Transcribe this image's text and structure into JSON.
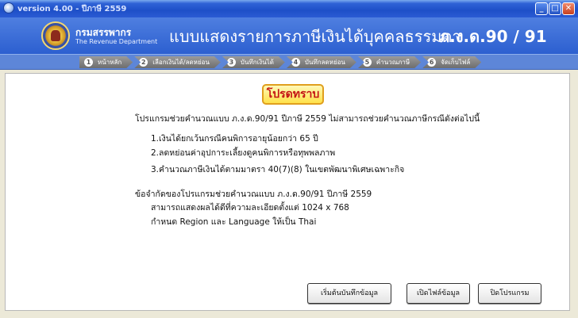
{
  "window": {
    "title": "version 4.00 - ปีภาษี 2559"
  },
  "header": {
    "dept_th": "กรมสรรพากร",
    "dept_en": "The Revenue Department",
    "form_title": "แบบแสดงรายการภาษีเงินได้บุคคลธรรมดา",
    "form_code": "ภ.ง.ด.90 / 91"
  },
  "steps": [
    {
      "num": "1",
      "label": "หน้าหลัก"
    },
    {
      "num": "2",
      "label": "เลือกเงินได้/ลดหย่อน"
    },
    {
      "num": "3",
      "label": "บันทึกเงินได้"
    },
    {
      "num": "4",
      "label": "บันทึกลดหย่อน"
    },
    {
      "num": "5",
      "label": "คำนวณภาษี"
    },
    {
      "num": "6",
      "label": "จัดเก็บไฟล์"
    }
  ],
  "notice": {
    "badge": "โปรดทราบ",
    "intro": "โปรแกรมช่วยคำนวณแบบ ภ.ง.ด.90/91 ปีภาษี 2559 ไม่สามารถช่วยคำนวณภาษีกรณีดังต่อไปนี้",
    "items": [
      "1.เงินได้ยกเว้นกรณีคนพิการอายุน้อยกว่า 65 ปี",
      "2.ลดหย่อนค่าอุปการะเลี้ยงดูคนพิการหรือทุพพลภาพ",
      "3.คำนวณภาษีเงินได้ตามมาตรา 40(7)(8) ในเขตพัฒนาพิเศษเฉพาะกิจ"
    ],
    "limits_title": "ข้อจำกัดของโปรแกรมช่วยคำนวณแบบ ภ.ง.ด.90/91 ปีภาษี 2559",
    "limits": [
      "สามารถแสดงผลได้ดีที่ความละเอียดตั้งแต่ 1024 x 768",
      "กำหนด Region และ Language ให้เป็น Thai"
    ]
  },
  "buttons": {
    "start": "เริ่มต้นบันทึกข้อมูล",
    "open": "เปิดไฟล์ข้อมูล",
    "close": "ปิดโปรแกรม"
  },
  "colors": {
    "accent": "#2c5fd0",
    "badge_text": "#c41414",
    "badge_bg": "#ffe14a"
  }
}
